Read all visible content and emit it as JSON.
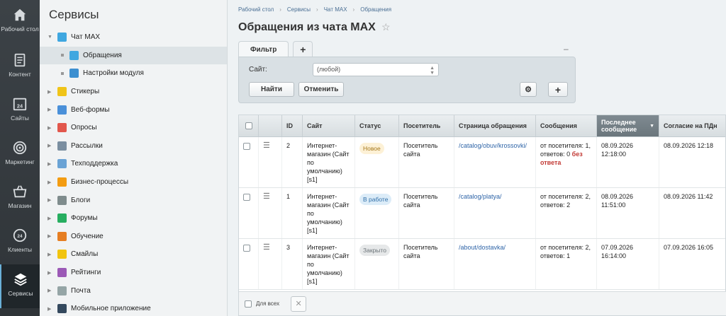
{
  "rail": {
    "items": [
      {
        "label": "Рабочий стол",
        "icon": "home-icon"
      },
      {
        "label": "Контент",
        "icon": "document-icon"
      },
      {
        "label": "Сайты",
        "icon": "calendar-24-icon"
      },
      {
        "label": "Маркетинг",
        "icon": "target-icon"
      },
      {
        "label": "Магазин",
        "icon": "basket-icon"
      },
      {
        "label": "Клиенты",
        "icon": "clients-24-icon"
      },
      {
        "label": "Сервисы",
        "icon": "layers-icon"
      }
    ]
  },
  "sidebar": {
    "title": "Сервисы",
    "items": [
      {
        "label": "Чат MAX",
        "expanded": true,
        "color": "#3fa7e0"
      },
      {
        "label": "Обращения",
        "child": true,
        "selected": true,
        "color": "#3fa7e0"
      },
      {
        "label": "Настройки модуля",
        "child": true,
        "color": "#3c8fd0"
      },
      {
        "label": "Стикеры",
        "color": "#f0c419"
      },
      {
        "label": "Веб-формы",
        "color": "#4a90d9"
      },
      {
        "label": "Опросы",
        "color": "#e2574c"
      },
      {
        "label": "Рассылки",
        "color": "#7a8ea0"
      },
      {
        "label": "Техподдержка",
        "color": "#6aa3d5"
      },
      {
        "label": "Бизнес-процессы",
        "color": "#f39c12"
      },
      {
        "label": "Блоги",
        "color": "#7f8c8d"
      },
      {
        "label": "Форумы",
        "color": "#27ae60"
      },
      {
        "label": "Обучение",
        "color": "#e67e22"
      },
      {
        "label": "Смайлы",
        "color": "#f1c40f"
      },
      {
        "label": "Рейтинги",
        "color": "#9b59b6"
      },
      {
        "label": "Почта",
        "color": "#95a5a6"
      },
      {
        "label": "Мобильное приложение",
        "color": "#34495e"
      }
    ]
  },
  "breadcrumb": [
    "Рабочий стол",
    "Сервисы",
    "Чат MAX",
    "Обращения"
  ],
  "page": {
    "title": "Обращения из чата MAX"
  },
  "filter": {
    "tab_label": "Фильтр",
    "add_tab": "+",
    "minimize": "–",
    "site_label": "Сайт:",
    "site_value": "(любой)",
    "find_label": "Найти",
    "cancel_label": "Отменить",
    "add_label": "+"
  },
  "table": {
    "columns": [
      "ID",
      "Сайт",
      "Статус",
      "Посетитель",
      "Страница обращения",
      "Сообщения",
      "Последнее сообщение",
      "Согласие на ПДн"
    ],
    "rows": [
      {
        "id": "2",
        "site": "Интернет-магазин (Сайт по умолчанию) [s1]",
        "status": "Новое",
        "status_bg": "#fdf1d6",
        "status_fg": "#a5781b",
        "visitor": "Посетитель сайта",
        "page": "/catalog/obuv/krossovki/",
        "messages": "от посетителя: 1, ответов: 0",
        "messages_alert": "без ответа",
        "last": "08.09.2026 12:18:00",
        "consent": "08.09.2026 12:18"
      },
      {
        "id": "1",
        "site": "Интернет-магазин (Сайт по умолчанию) [s1]",
        "status": "В работе",
        "status_bg": "#dcecf8",
        "status_fg": "#2f6ea8",
        "visitor": "Посетитель сайта",
        "page": "/catalog/platya/",
        "messages": "от посетителя: 2, ответов: 2",
        "messages_alert": "",
        "last": "08.09.2026 11:51:00",
        "consent": "08.09.2026 11:42"
      },
      {
        "id": "3",
        "site": "Интернет-магазин (Сайт по умолчанию) [s1]",
        "status": "Закрыто",
        "status_bg": "#e6e8e9",
        "status_fg": "#6b7378",
        "visitor": "Посетитель сайта",
        "page": "/about/dostavka/",
        "messages": "от посетителя: 2, ответов: 1",
        "messages_alert": "",
        "last": "07.09.2026 16:14:00",
        "consent": "07.09.2026 16:05"
      }
    ],
    "footer_label": "Для всех",
    "sorted_column": "Последнее сообщение"
  }
}
